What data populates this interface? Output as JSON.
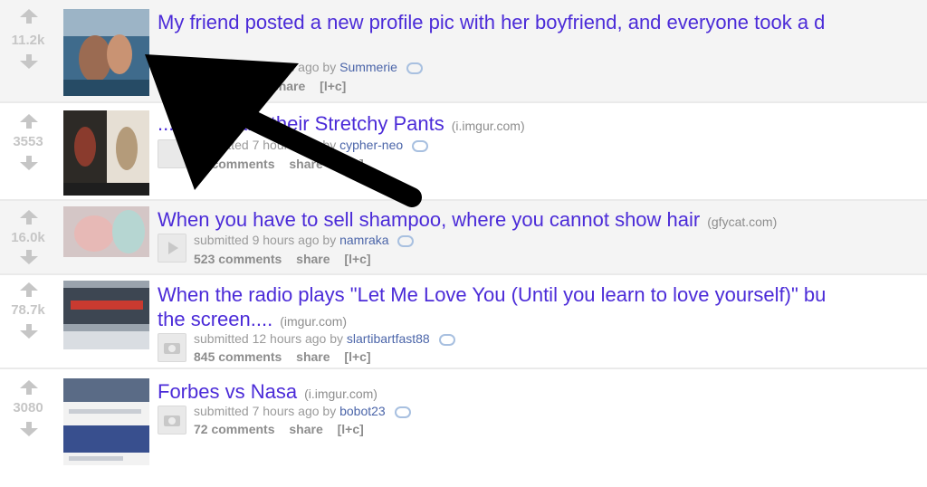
{
  "posts": [
    {
      "score": "11.2k",
      "title": "My friend posted a new profile pic with her boyfriend, and everyone took a d",
      "domain": "",
      "submitted": "submitted 7 hours ago by",
      "user": "Summerie",
      "comments": "comments",
      "share": "share",
      "lc": "[l+c]"
    },
    {
      "score": "3553",
      "title": "...you Share their Stretchy Pants",
      "domain": "(i.imgur.com)",
      "submitted": "submitted 7 hours ago by",
      "user": "cypher-neo",
      "comments": "45 comments",
      "share": "share",
      "lc": "[l+c]"
    },
    {
      "score": "16.0k",
      "title": "When you have to sell shampoo, where you cannot show hair",
      "domain": "(gfycat.com)",
      "submitted": "submitted 9 hours ago by",
      "user": "namraka",
      "comments": "523 comments",
      "share": "share",
      "lc": "[l+c]"
    },
    {
      "score": "78.7k",
      "title_line1": "When the radio plays \"Let Me Love You (Until you learn to love yourself)\" bu",
      "title_line2": "the screen....",
      "domain": "(imgur.com)",
      "submitted": "submitted 12 hours ago by",
      "user": "slartibartfast88",
      "comments": "845 comments",
      "share": "share",
      "lc": "[l+c]"
    },
    {
      "score": "3080",
      "title": "Forbes vs Nasa",
      "domain": "(i.imgur.com)",
      "submitted": "submitted 7 hours ago by",
      "user": "bobot23",
      "comments": "72 comments",
      "share": "share",
      "lc": "[l+c]"
    }
  ],
  "colors": {
    "title": "#4b2bd8",
    "user": "#4b65a9",
    "score": "#c6c6c6"
  }
}
